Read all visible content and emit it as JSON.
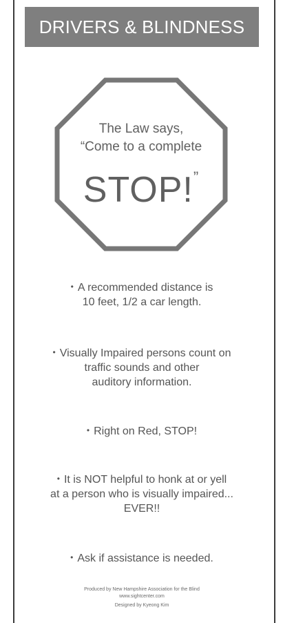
{
  "header": {
    "title": "DRIVERS & BLINDNESS"
  },
  "stop_sign": {
    "line1": "The Law says,",
    "line2": "“Come to a complete",
    "word": "STOP!",
    "close_quote": "”"
  },
  "bullets": [
    {
      "lines": [
        "A recommended distance is",
        "10 feet, 1/2 a car length."
      ]
    },
    {
      "lines": [
        "Visually Impaired persons count on",
        "traffic sounds and other",
        "auditory information."
      ]
    },
    {
      "lines": [
        "Right on Red, STOP!"
      ]
    },
    {
      "lines": [
        "It is NOT helpful to honk at or yell",
        "at a person who is visually impaired...",
        "EVER!!"
      ]
    },
    {
      "lines": [
        "Ask if assistance is needed."
      ]
    }
  ],
  "bullet_glyph": "•",
  "footer": {
    "produced_by": "Produced by New Hampshire Association for the Blind",
    "website": "www.sightcenter.com",
    "designer": "Designed by Kyeong Kim"
  },
  "colors": {
    "header_bg": "#7f7f7f",
    "stop_outline": "#777777",
    "text": "#555555",
    "frame": "#3a3a3a"
  }
}
